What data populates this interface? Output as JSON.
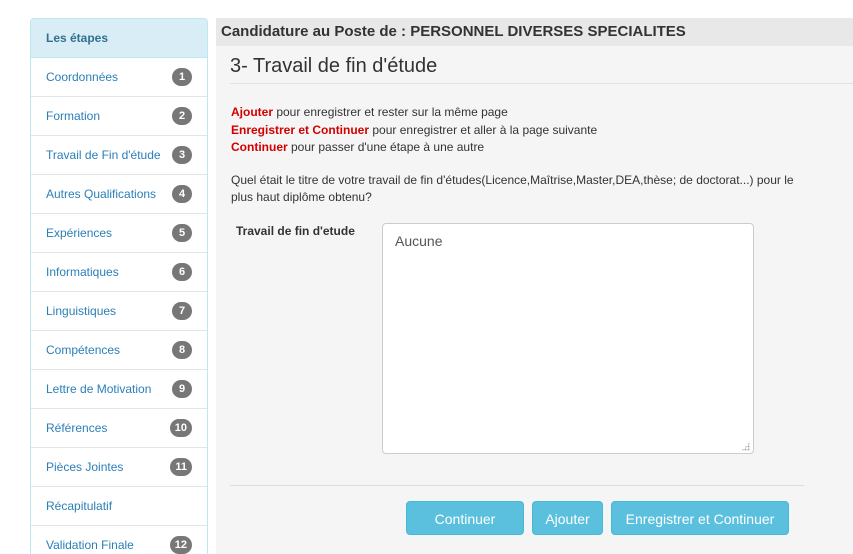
{
  "sidebar": {
    "header": "Les étapes",
    "items": [
      {
        "label": "Coordonnées",
        "badge": "1"
      },
      {
        "label": "Formation",
        "badge": "2"
      },
      {
        "label": "Travail de Fin d'étude",
        "badge": "3"
      },
      {
        "label": "Autres Qualifications",
        "badge": "4"
      },
      {
        "label": "Expériences",
        "badge": "5"
      },
      {
        "label": "Informatiques",
        "badge": "6"
      },
      {
        "label": "Linguistiques",
        "badge": "7"
      },
      {
        "label": "Compétences",
        "badge": "8"
      },
      {
        "label": "Lettre de Motivation",
        "badge": "9"
      },
      {
        "label": "Références",
        "badge": "10"
      },
      {
        "label": "Pièces Jointes",
        "badge": "11"
      },
      {
        "label": "Récapitulatif",
        "badge": ""
      },
      {
        "label": "Validation Finale",
        "badge": "12"
      }
    ]
  },
  "main": {
    "title": "Candidature au Poste de : PERSONNEL DIVERSES SPECIALITES",
    "step_title": "3- Travail de fin d'étude",
    "instructions": [
      {
        "keyword": "Ajouter",
        "text": " pour enregistrer et rester sur la même page"
      },
      {
        "keyword": "Enregistrer et Continuer",
        "text": " pour enregistrer et aller à la page suivante"
      },
      {
        "keyword": "Continuer",
        "text": " pour passer d'une étape à une autre"
      }
    ],
    "question": "Quel était le titre de votre travail de fin d'études(Licence,Maîtrise,Master,DEA,thèse; de doctorat...) pour le plus haut diplôme obtenu?",
    "field_label": "Travail de fin d'etude",
    "field_value": "Aucune",
    "buttons": {
      "continuer": "Continuer",
      "ajouter": "Ajouter",
      "enregistrer": "Enregistrer et Continuer"
    }
  },
  "colors": {
    "accent": "#5bc0de",
    "keyword": "#d20000",
    "link": "#2a7fb8",
    "badge": "#777777"
  }
}
